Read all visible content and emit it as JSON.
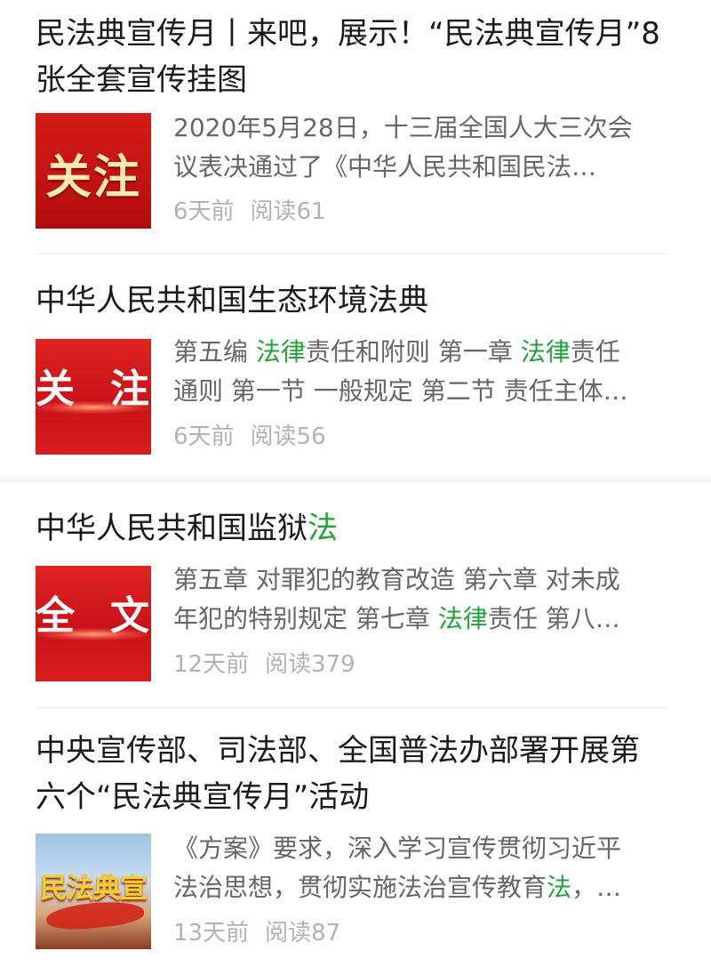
{
  "articles": [
    {
      "title": "民法典宣传月丨来吧，展示！“民法典宣传月”8张全套宣传挂图",
      "thumb_text": "关注",
      "body_lines": [
        [
          {
            "t": "2020年5月28日，十三届全国人大三次会",
            "h": false
          }
        ],
        [
          {
            "t": "议表决通过了《中华人民共和国民法…",
            "h": false
          }
        ]
      ],
      "time": "6天前",
      "reads": "阅读61"
    },
    {
      "title": "中华人民共和国生态环境法典",
      "thumb_left": "关",
      "thumb_right": "注",
      "body_lines": [
        [
          {
            "t": "第五编 ",
            "h": false
          },
          {
            "t": "法律",
            "h": true
          },
          {
            "t": "责任和附则 第一章 ",
            "h": false
          },
          {
            "t": "法律",
            "h": true
          },
          {
            "t": "责任",
            "h": false
          }
        ],
        [
          {
            "t": "通则 第一节 一般规定 第二节 责任主体…",
            "h": false
          }
        ]
      ],
      "time": "6天前",
      "reads": "阅读56"
    },
    {
      "title_parts": [
        {
          "t": "中华人民共和国监狱",
          "h": false
        },
        {
          "t": "法",
          "h": true
        }
      ],
      "thumb_left": "全",
      "thumb_right": "文",
      "body_lines": [
        [
          {
            "t": "第五章 对罪犯的教育改造 第六章 对未成",
            "h": false
          }
        ],
        [
          {
            "t": "年犯的特别规定 第七章 ",
            "h": false
          },
          {
            "t": "法律",
            "h": true
          },
          {
            "t": "责任 第八…",
            "h": false
          }
        ]
      ],
      "time": "12天前",
      "reads": "阅读379"
    },
    {
      "title": "中央宣传部、司法部、全国普法办部署开展第六个“民法典宣传月”活动",
      "thumb_text": "民法典宣",
      "body_lines": [
        [
          {
            "t": "《方案》要求，深入学习宣传贯彻习近平",
            "h": false
          }
        ],
        [
          {
            "t": "法治思想，贯彻实施法治宣传教育",
            "h": false
          },
          {
            "t": "法",
            "h": true
          },
          {
            "t": "，…",
            "h": false
          }
        ]
      ],
      "time": "13天前",
      "reads": "阅读87"
    }
  ],
  "colors": {
    "highlight": "#22a338",
    "meta": "#b2b2b2",
    "body": "#666666"
  }
}
